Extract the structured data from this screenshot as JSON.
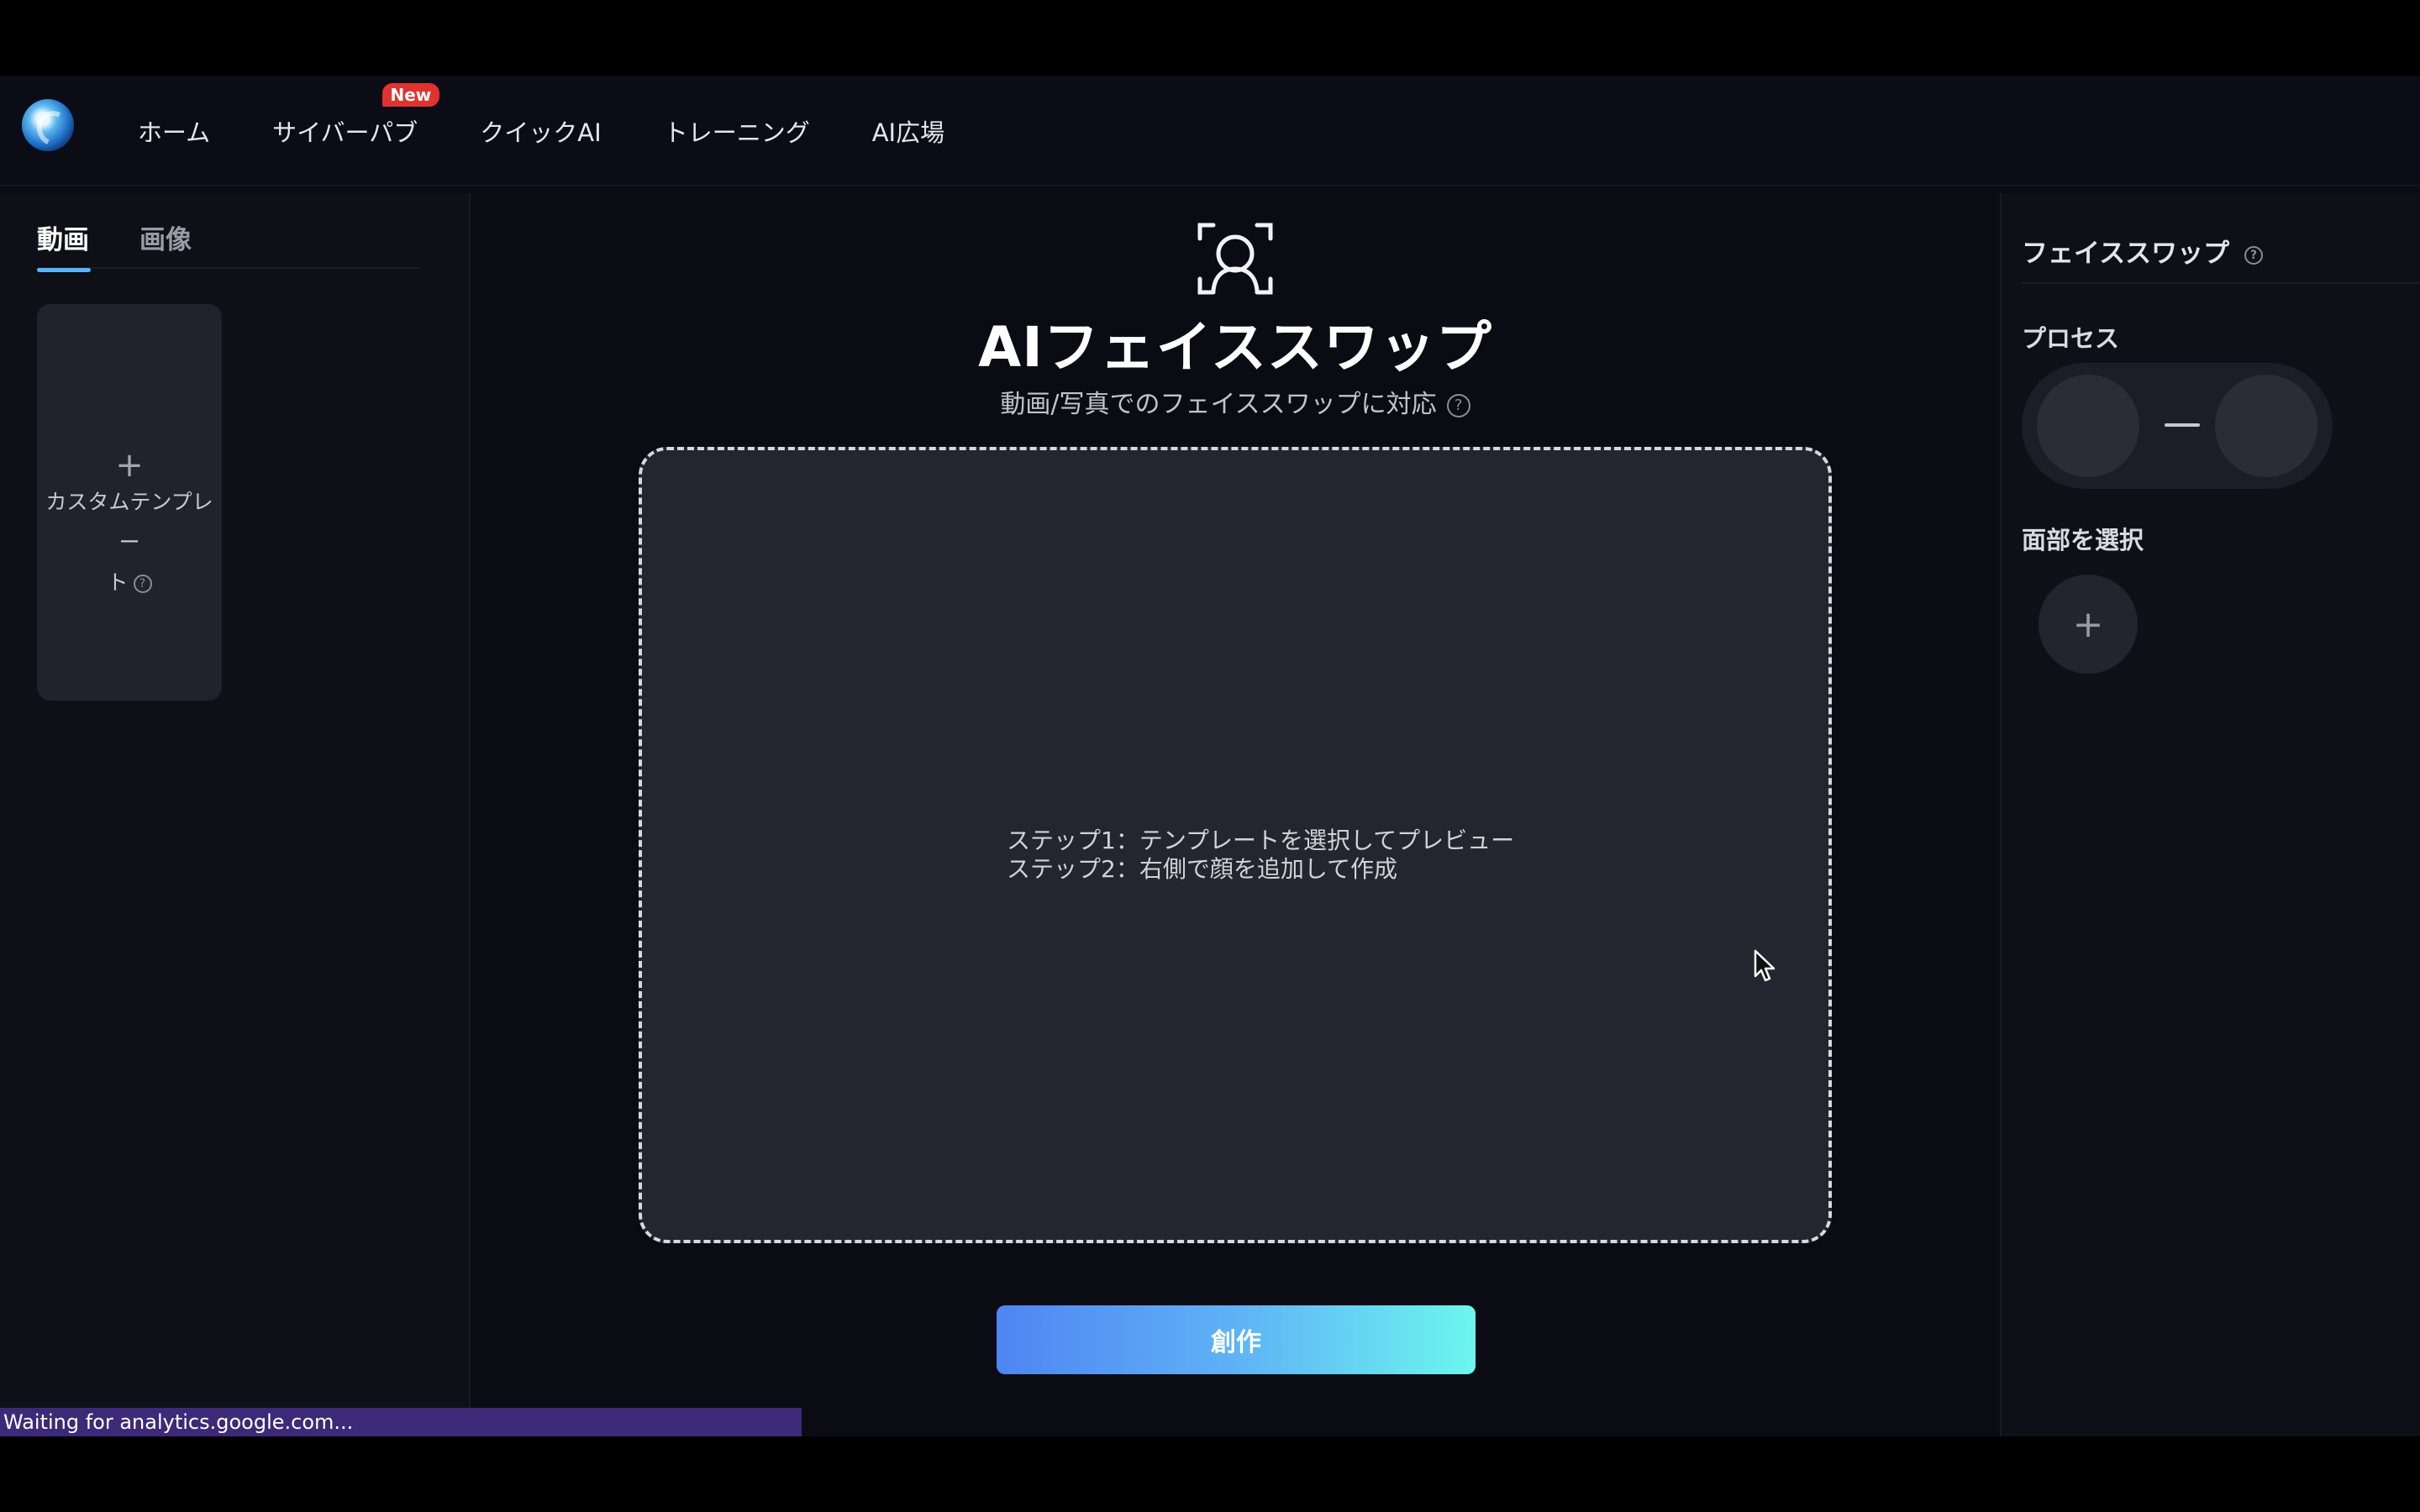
{
  "header": {
    "nav": [
      {
        "label": "ホーム"
      },
      {
        "label": "サイバーパブ",
        "badge": "New"
      },
      {
        "label": "クイックAI"
      },
      {
        "label": "トレーニング"
      },
      {
        "label": "AI広場"
      }
    ]
  },
  "left": {
    "tabs": [
      {
        "label": "動画",
        "active": true
      },
      {
        "label": "画像",
        "active": false
      }
    ],
    "template_card": {
      "plus": "+",
      "label_line1": "カスタムテンプレー",
      "label_line2": "ト"
    }
  },
  "center": {
    "title": "AIフェイススワップ",
    "subtitle": "動画/写真でのフェイススワップに対応",
    "steps": [
      "ステップ1：テンプレートを選択してプレビュー",
      "ステップ2：右側で顔を追加して作成"
    ],
    "create_label": "創作"
  },
  "right": {
    "title": "フェイススワップ",
    "process_label": "プロセス",
    "select_face_label": "面部を選択",
    "add_symbol": "+"
  },
  "status": {
    "text": "Waiting for analytics.google.com..."
  },
  "colors": {
    "background": "#0b0b14",
    "panel": "#0f0f18",
    "accent": "#5ab4f5",
    "button_gradient_start": "#4f85f2",
    "button_gradient_end": "#6cf6ee",
    "badge": "#e0332f",
    "status_bar": "#3c2a78"
  }
}
